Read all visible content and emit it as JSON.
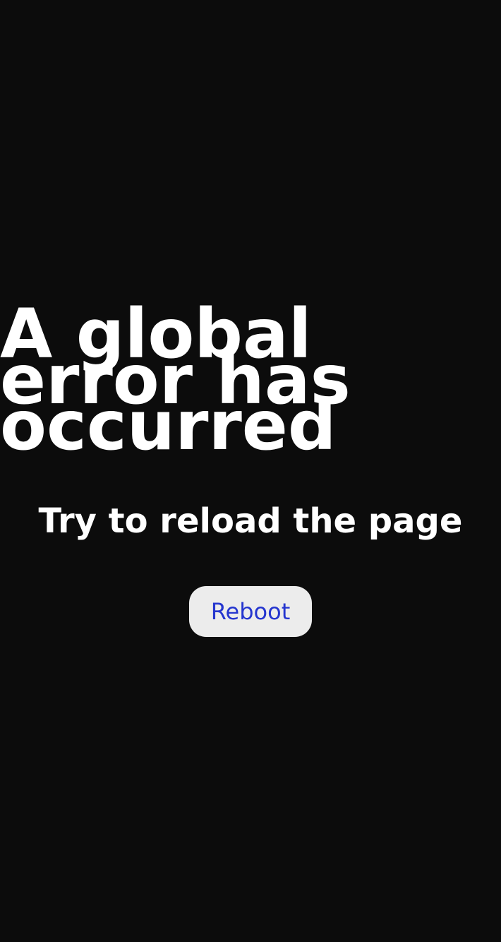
{
  "error": {
    "title": "A global error has occurred",
    "subtitle": "Try to reload the page",
    "button_label": "Reboot"
  },
  "colors": {
    "background": "#0c0c0c",
    "text": "#ffffff",
    "button_background": "#ececec",
    "button_text": "#2536cf"
  }
}
